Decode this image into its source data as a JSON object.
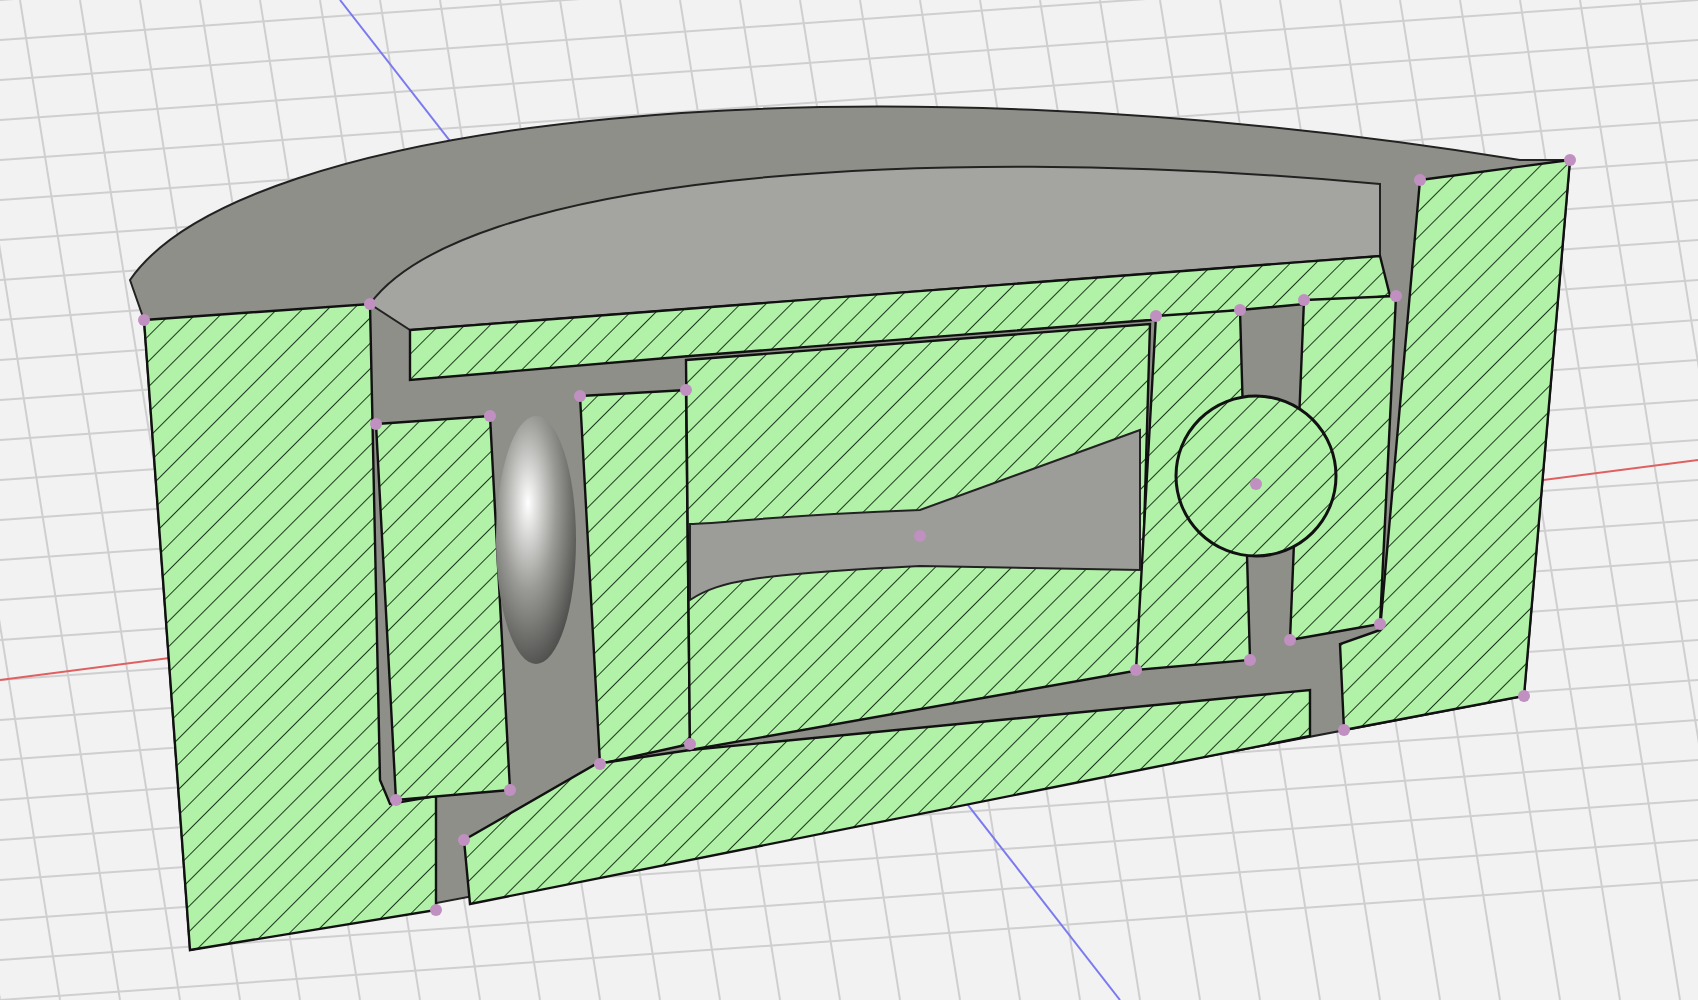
{
  "viewport": {
    "kind": "section-view"
  }
}
